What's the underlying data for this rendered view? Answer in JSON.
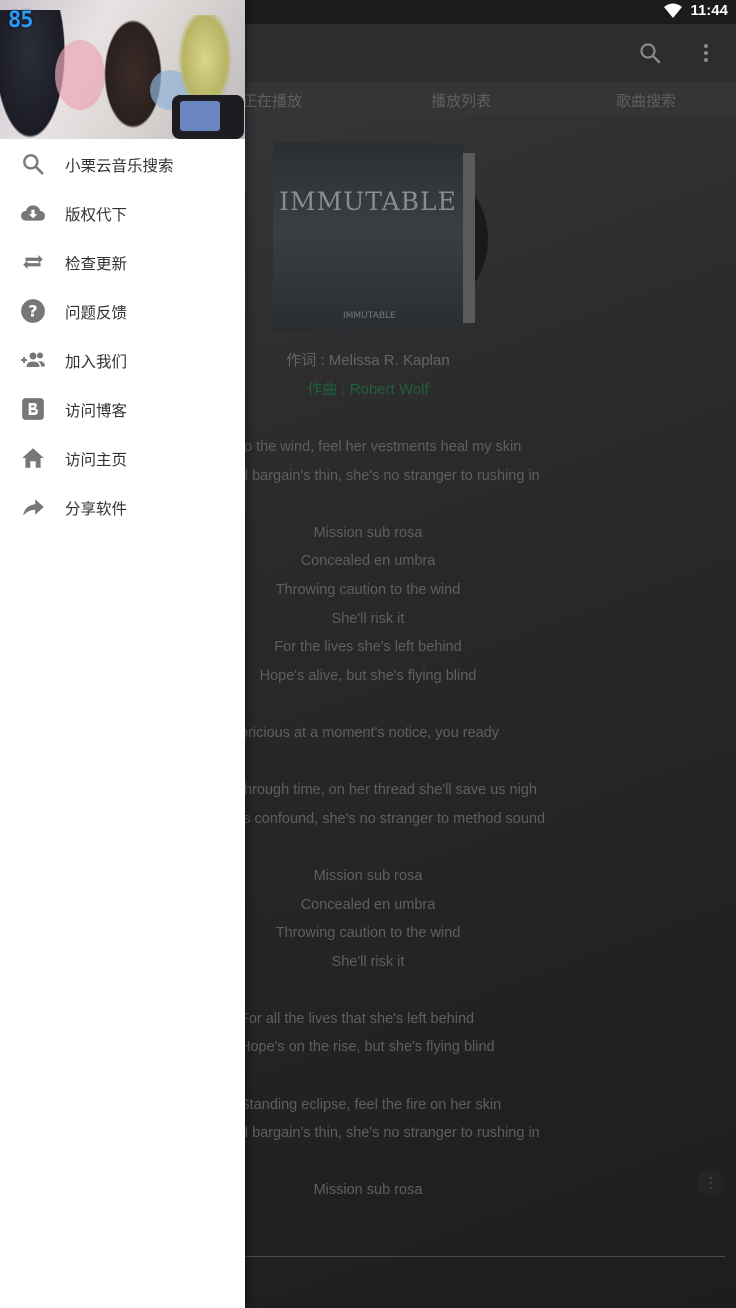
{
  "status_bar": {
    "time": "11:44"
  },
  "toolbar": {
    "search_icon": "search-icon",
    "more_icon": "more-vert-icon"
  },
  "tabs": [
    {
      "label": "正在播放"
    },
    {
      "label": "播放列表"
    },
    {
      "label": "歌曲搜索"
    }
  ],
  "album": {
    "title": "IMMUTABLE",
    "subtitle": "IMMUTABLE"
  },
  "credits": {
    "lyricist": "作词 : Melissa R. Kaplan",
    "composer": "作曲 : Robert Wolf"
  },
  "lyrics": [
    "to the wind, feel her vestments heal my skin",
    "d bargain's thin, she's no stranger to rushing in",
    "",
    "Mission sub rosa",
    "Concealed en umbra",
    "Throwing caution to the wind",
    "She'll risk it",
    "For the lives she's left behind",
    "Hope's alive, but she's flying blind",
    "",
    "pricious at a moment's notice, you ready",
    "",
    "through time, on her thread she'll save us nigh",
    "is confound, she's no stranger to method sound",
    "",
    "Mission sub rosa",
    "Concealed en umbra",
    "Throwing caution to the wind",
    "She'll risk it",
    "",
    "For all the lives that she's left behind",
    "Hope's on the rise, but she's flying blind",
    "",
    "Standing eclipse, feel the fire on her skin",
    "d bargain's thin, she's no stranger to rushing in",
    "",
    "Mission sub rosa"
  ],
  "drawer": {
    "badge": "85",
    "items": [
      {
        "label": "小栗云音乐搜索",
        "icon": "search-icon"
      },
      {
        "label": "版权代下",
        "icon": "cloud-download-icon"
      },
      {
        "label": "检查更新",
        "icon": "repeat-icon"
      },
      {
        "label": "问题反馈",
        "icon": "help-icon"
      },
      {
        "label": "加入我们",
        "icon": "group-add-icon"
      },
      {
        "label": "访问博客",
        "icon": "blogger-icon"
      },
      {
        "label": "访问主页",
        "icon": "home-icon"
      },
      {
        "label": "分享软件",
        "icon": "share-icon"
      }
    ]
  },
  "colors": {
    "drawer_bg": "#ffffff",
    "icon_gray": "#777777",
    "credit_green": "#1f5f3b",
    "badge_blue": "#2b9cf0"
  }
}
